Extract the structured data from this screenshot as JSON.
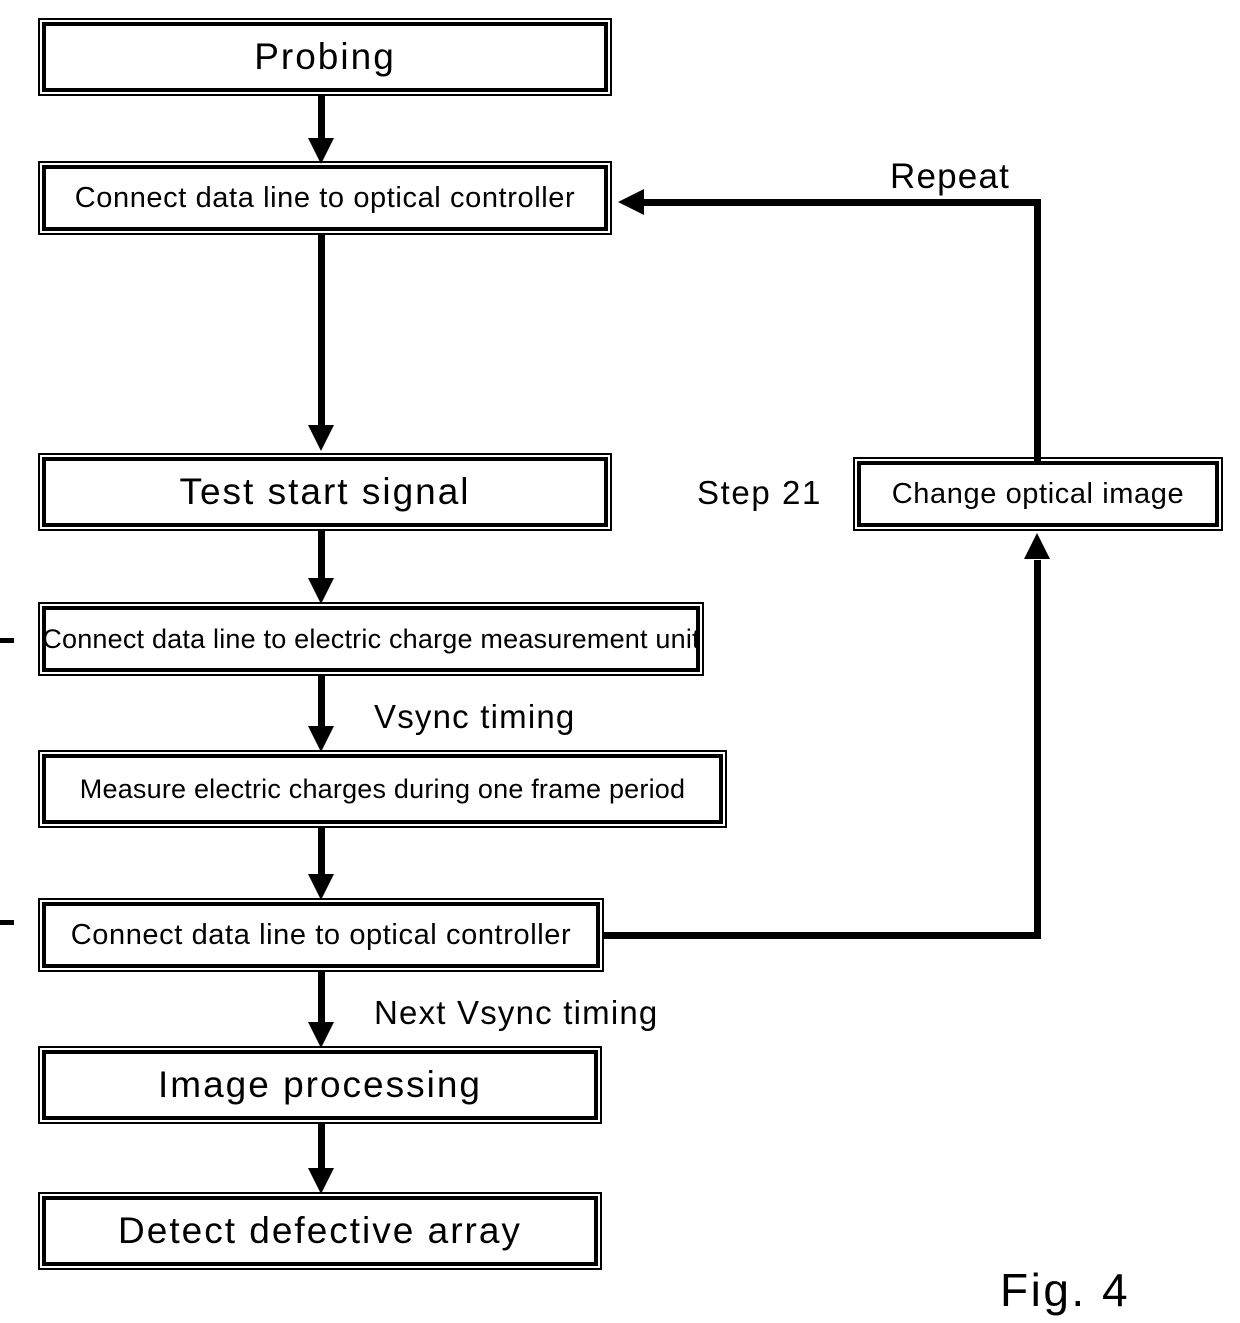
{
  "figure": {
    "caption": "Fig. 4",
    "type": "flowchart",
    "background_color": "#ffffff",
    "line_color": "#000000"
  },
  "nodes": [
    {
      "id": "probing",
      "label": "Probing"
    },
    {
      "id": "connect-optical-1",
      "label": "Connect data line to optical controller"
    },
    {
      "id": "test-start",
      "label": "Test start signal"
    },
    {
      "id": "connect-charge",
      "label": "Connect data line to electric charge measurement unit"
    },
    {
      "id": "measure-charges",
      "label": "Measure electric charges during one frame period"
    },
    {
      "id": "connect-optical-2",
      "label": "Connect data line to optical controller"
    },
    {
      "id": "image-processing",
      "label": "Image processing"
    },
    {
      "id": "detect-defective",
      "label": "Detect defective array"
    },
    {
      "id": "change-optical",
      "label": "Change optical image"
    }
  ],
  "annotations": {
    "repeat": "Repeat",
    "step21": "Step 21",
    "vsync_timing": "Vsync timing",
    "next_vsync_timing": "Next Vsync timing"
  },
  "edges": [
    {
      "from": "probing",
      "to": "connect-optical-1",
      "label": ""
    },
    {
      "from": "connect-optical-1",
      "to": "test-start",
      "label": ""
    },
    {
      "from": "test-start",
      "to": "connect-charge",
      "label": ""
    },
    {
      "from": "connect-charge",
      "to": "measure-charges",
      "label": "Vsync timing"
    },
    {
      "from": "measure-charges",
      "to": "connect-optical-2",
      "label": ""
    },
    {
      "from": "connect-optical-2",
      "to": "image-processing",
      "label": "Next Vsync timing"
    },
    {
      "from": "image-processing",
      "to": "detect-defective",
      "label": ""
    },
    {
      "from": "connect-optical-2",
      "to": "change-optical",
      "label": ""
    },
    {
      "from": "change-optical",
      "to": "connect-optical-1",
      "label": "Repeat"
    }
  ]
}
